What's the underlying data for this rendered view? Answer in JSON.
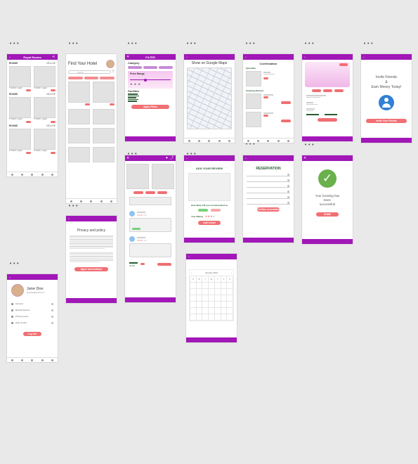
{
  "ellipsis": "•••",
  "room": {
    "title": "Royal Rooms",
    "price_label": "₹ 1500 / night"
  },
  "find": {
    "title": "Find Your Hotel",
    "search_placeholder": "Search"
  },
  "filter": {
    "title": "FILTER",
    "category": "Category",
    "price_range": "Price Range",
    "facilities": "Facilities",
    "apply": "Apply Filters"
  },
  "map": {
    "title": "Show on Google Maps"
  },
  "confirm": {
    "title": "Confirmation",
    "speciality": "Speciality",
    "smoking": "Smoking Allowed"
  },
  "invite": {
    "line1": "Invite Friends",
    "line2": "&",
    "line3": "Earn Money Today!",
    "button": "Invite Your Friends"
  },
  "privacy": {
    "title": "Privacy and policy",
    "button": "Agree and continue"
  },
  "review": {
    "title": "ADD YOUR REVIEW",
    "question": "How likely will you recommended us",
    "rating_label": "Your Rating",
    "button": "Add review"
  },
  "reservation": {
    "title": "RESERVATION",
    "button": "Confirm reservation"
  },
  "success": {
    "line1": "Your booking has",
    "line2": "been",
    "line3": "successful!",
    "button": "HOME"
  },
  "calendar": {
    "month": "January 2021",
    "days": [
      "S",
      "M",
      "T",
      "W",
      "T",
      "F",
      "S"
    ]
  },
  "profile": {
    "name": "Jane Doe",
    "email": "janedoe@gmail.com",
    "items": [
      "Account",
      "Booked Rooms",
      "Privacy policy",
      "Help Center"
    ],
    "logout": "Log Out"
  },
  "colors": {
    "purple": "#a117b8",
    "coral": "#f06f73",
    "success": "#6ab04c"
  }
}
